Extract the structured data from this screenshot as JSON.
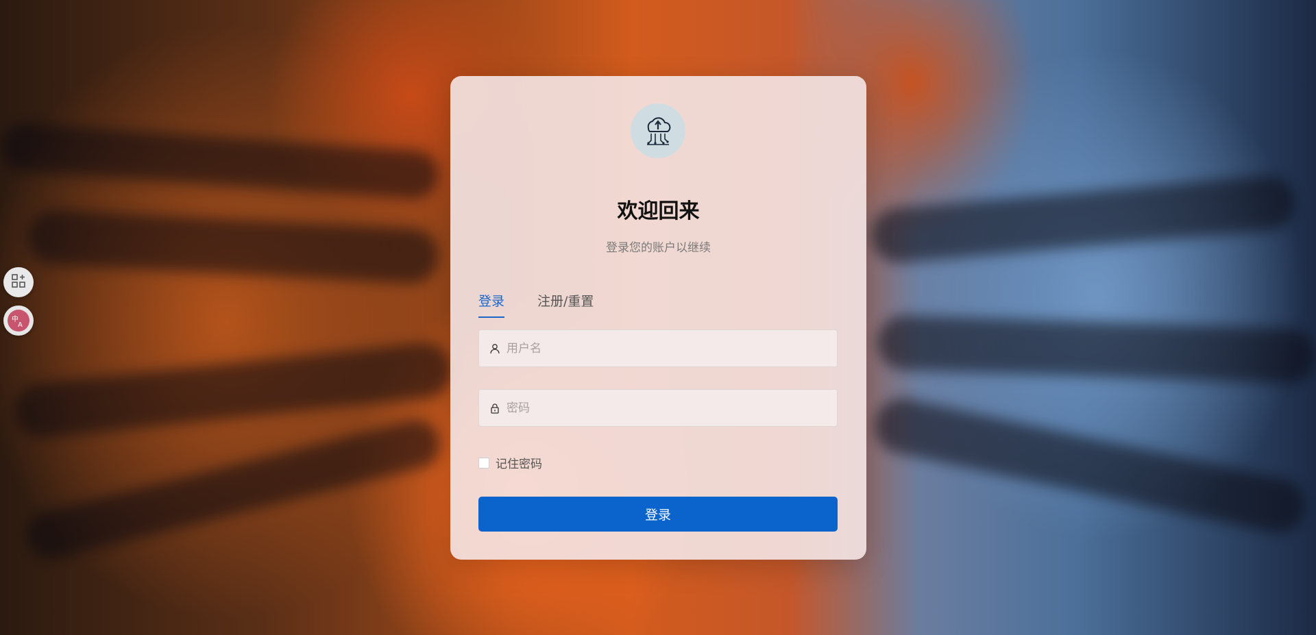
{
  "login": {
    "title": "欢迎回来",
    "subtitle": "登录您的账户以继续",
    "tabs": [
      {
        "label": "登录",
        "active": true
      },
      {
        "label": "注册/重置",
        "active": false
      }
    ],
    "username": {
      "placeholder": "用户名",
      "value": "",
      "icon": "user-icon"
    },
    "password": {
      "placeholder": "密码",
      "value": "",
      "icon": "lock-icon"
    },
    "remember_label": "记住密码",
    "remember_checked": false,
    "submit_label": "登录",
    "logo_icon": "cloud-circuit-logo"
  },
  "side_tools": [
    {
      "icon": "apps-add-icon"
    },
    {
      "icon": "translate-icon"
    }
  ],
  "colors": {
    "accent": "#0a64cc",
    "tab_active": "#1a66c9",
    "card_bg": "#f4e6e6"
  }
}
